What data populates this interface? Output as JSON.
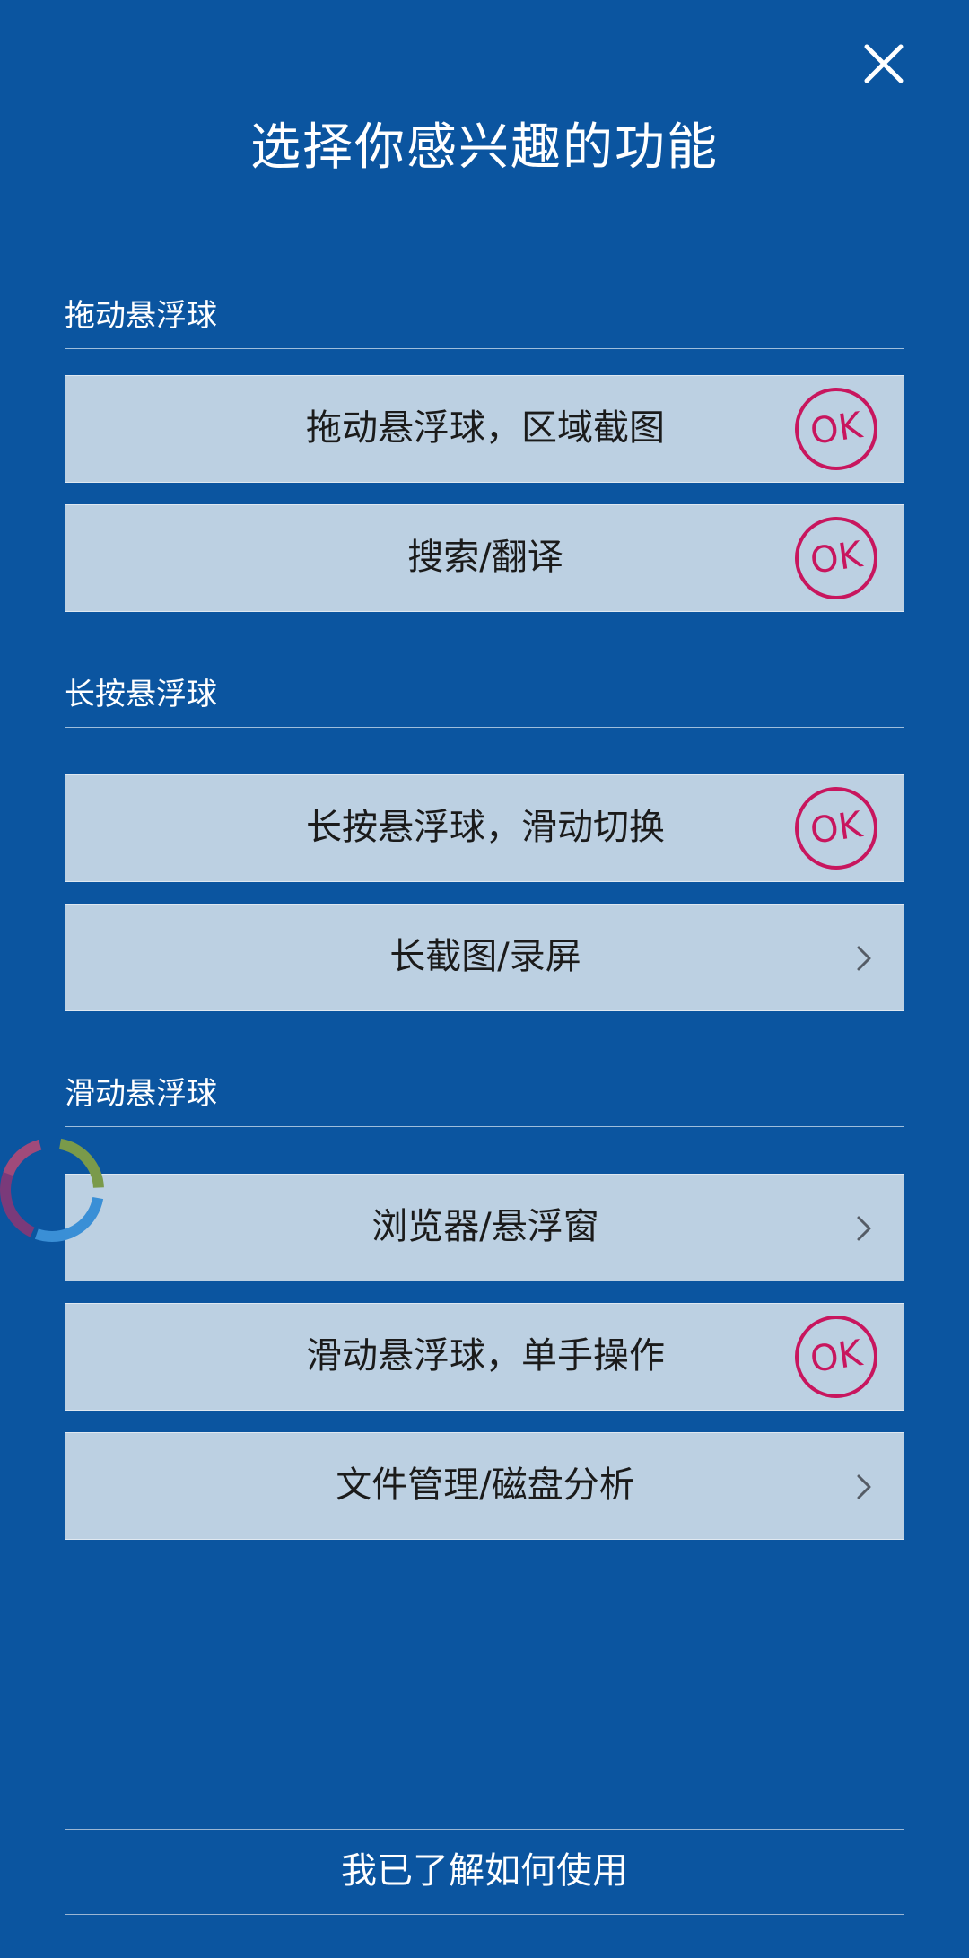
{
  "title": "选择你感兴趣的功能",
  "sections": [
    {
      "header": "拖动悬浮球",
      "items": [
        {
          "label": "拖动悬浮球，区域截图",
          "indicator": "ok"
        },
        {
          "label": "搜索/翻译",
          "indicator": "ok"
        }
      ]
    },
    {
      "header": "长按悬浮球",
      "items": [
        {
          "label": "长按悬浮球，滑动切换",
          "indicator": "ok"
        },
        {
          "label": "长截图/录屏",
          "indicator": "chevron"
        }
      ]
    },
    {
      "header": "滑动悬浮球",
      "items": [
        {
          "label": "浏览器/悬浮窗",
          "indicator": "chevron"
        },
        {
          "label": "滑动悬浮球，单手操作",
          "indicator": "ok"
        },
        {
          "label": "文件管理/磁盘分析",
          "indicator": "chevron"
        }
      ]
    }
  ],
  "ok_badge_text": "OK",
  "confirm_button": "我已了解如何使用",
  "icons": {
    "close": "close-icon",
    "ok": "ok-stamp-icon",
    "chevron": "chevron-right-icon",
    "floating_ball": "floating-ball-icon"
  },
  "colors": {
    "background": "#0b55a0",
    "card": "#bcd0e2",
    "ok_stamp": "#c8165e"
  }
}
